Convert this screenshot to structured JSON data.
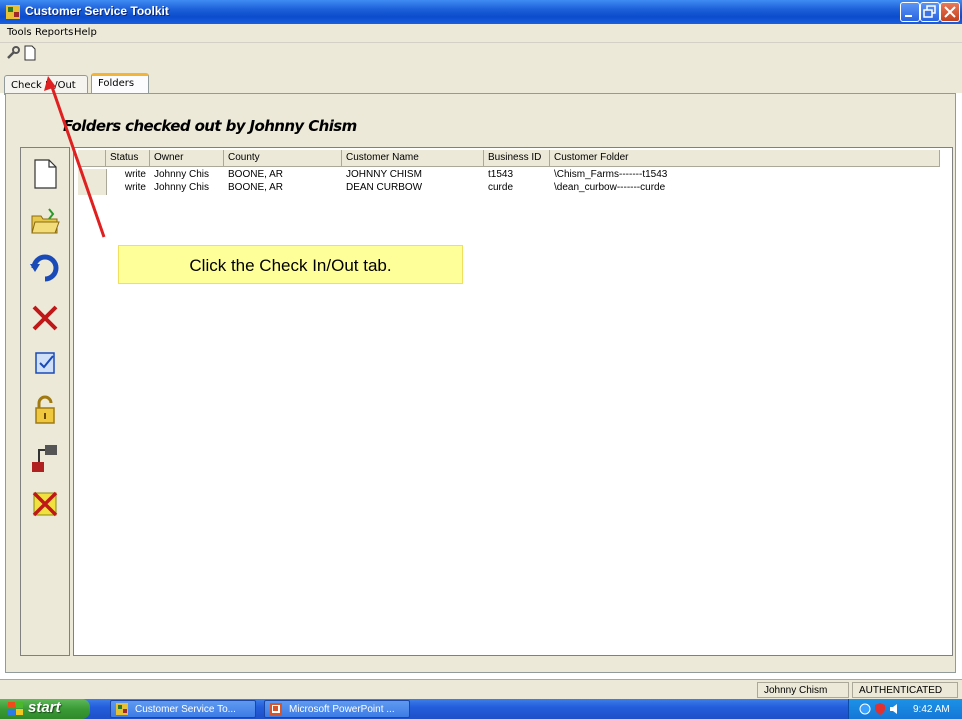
{
  "window": {
    "title": "Customer Service Toolkit"
  },
  "menu": {
    "items": [
      "Tools",
      "Reports",
      "Help"
    ]
  },
  "tabs": [
    {
      "label": "Check In/Out",
      "active": false
    },
    {
      "label": "Folders",
      "active": true
    }
  ],
  "panel": {
    "heading": "Folders checked out by Johnny Chism"
  },
  "grid": {
    "columns": [
      "Status",
      "Owner",
      "County",
      "Customer Name",
      "Business ID",
      "Customer Folder"
    ],
    "rows": [
      [
        "write",
        "Johnny Chis",
        "BOONE, AR",
        "JOHNNY CHISM",
        "t1543",
        "\\Chism_Farms-------t1543"
      ],
      [
        "write",
        "Johnny Chis",
        "BOONE, AR",
        "DEAN CURBOW",
        "curde",
        "\\dean_curbow-------curde"
      ]
    ]
  },
  "sidebar": {
    "buttons": [
      {
        "icon": "new-document-icon"
      },
      {
        "icon": "open-folder-icon"
      },
      {
        "icon": "refresh-icon"
      },
      {
        "icon": "delete-icon"
      },
      {
        "icon": "edit-check-icon"
      },
      {
        "icon": "unlock-icon"
      },
      {
        "icon": "plug-icon"
      },
      {
        "icon": "cancel-checkout-icon"
      }
    ]
  },
  "callout": {
    "text": "Click the Check In/Out tab."
  },
  "status": {
    "user": "Johnny Chism",
    "auth": "AUTHENTICATED"
  },
  "taskbar": {
    "start_label": "start",
    "tasks": [
      "Customer Service To...",
      "Microsoft PowerPoint ..."
    ],
    "clock": "9:42 AM"
  },
  "colors": {
    "title_bar": "#0a4ccc",
    "callout_bg": "#ffff99",
    "arrow": "#e02020",
    "active_tab_accent": "#f3b43a"
  }
}
